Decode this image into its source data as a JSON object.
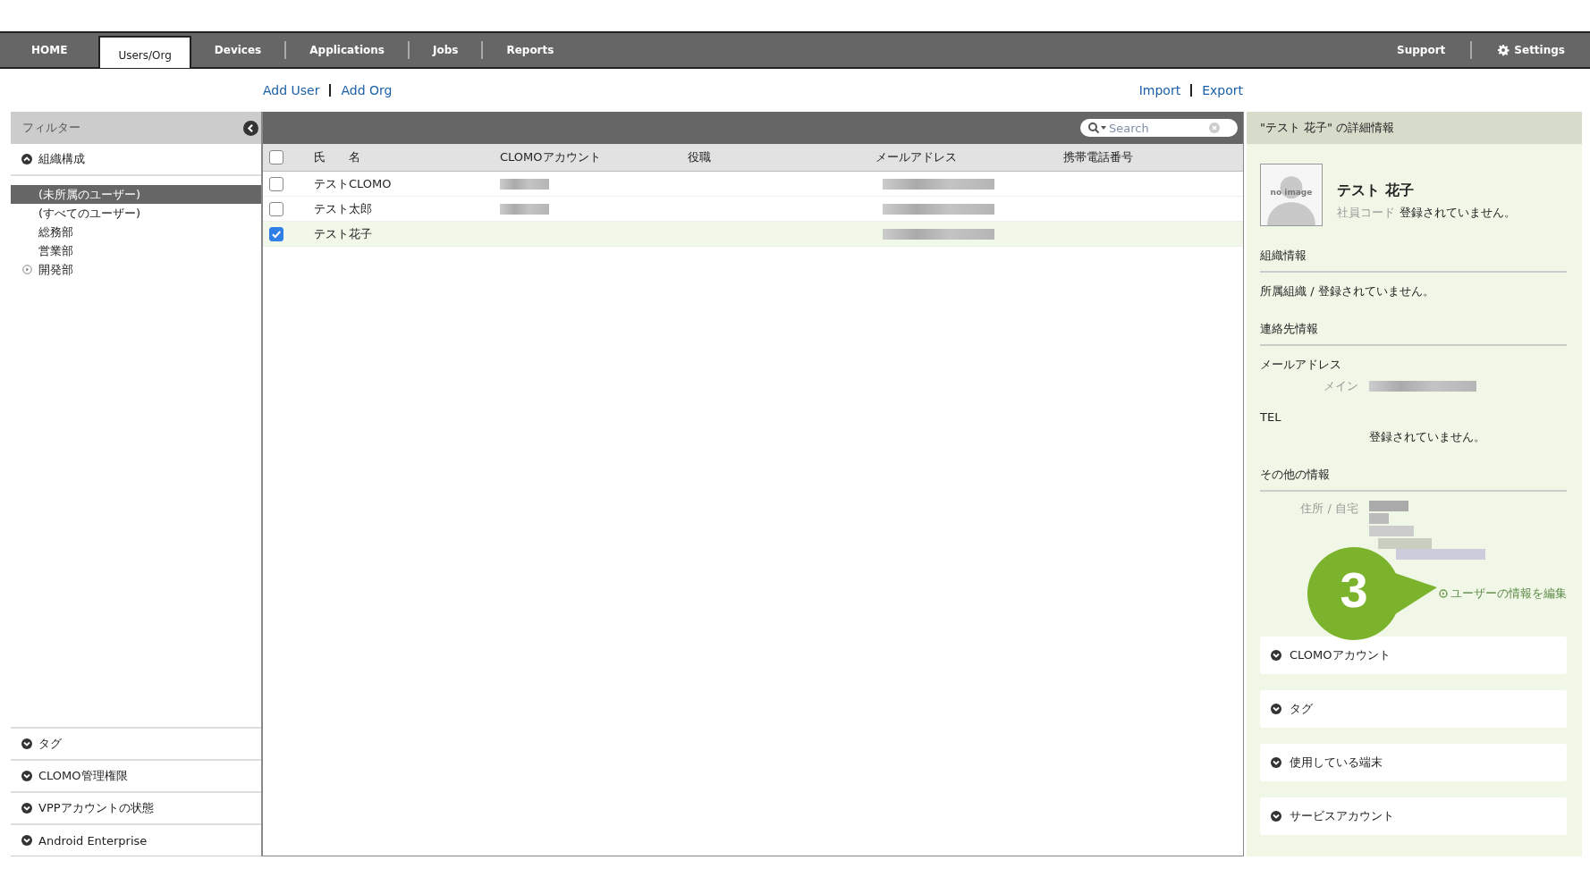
{
  "nav": {
    "tabs": [
      {
        "label": "HOME",
        "selected": false
      },
      {
        "label": "Users/Org",
        "selected": true
      },
      {
        "label": "Devices",
        "selected": false
      },
      {
        "label": "Applications",
        "selected": false
      },
      {
        "label": "Jobs",
        "selected": false
      },
      {
        "label": "Reports",
        "selected": false
      }
    ],
    "right": [
      {
        "label": "Support",
        "kind": "plain"
      },
      {
        "label": "Settings",
        "kind": "gear"
      }
    ]
  },
  "actions_left": [
    "Add User",
    "Add Org"
  ],
  "actions_right": [
    "Import",
    "Export"
  ],
  "filter": {
    "title": "フィルター",
    "section": {
      "label": "組織構成",
      "expanded": true
    },
    "items": [
      {
        "label": "(未所属のユーザー)",
        "selected": true,
        "kind": "leaf"
      },
      {
        "label": "(すべてのユーザー)",
        "selected": false,
        "kind": "leaf"
      },
      {
        "label": "総務部",
        "selected": false,
        "kind": "leaf"
      },
      {
        "label": "営業部",
        "selected": false,
        "kind": "leaf"
      },
      {
        "label": "開発部",
        "selected": false,
        "kind": "branch"
      }
    ],
    "groups": [
      "タグ",
      "CLOMO管理権限",
      "VPPアカウントの状態",
      "Android Enterprise"
    ]
  },
  "table": {
    "search": {
      "placeholder": "Search"
    },
    "header_checked": false,
    "columns": [
      "氏　　名",
      "CLOMOアカウント",
      "役職",
      "メールアドレス",
      "携帯電話番号"
    ],
    "rows": [
      {
        "name": "テストCLOMO",
        "checked": false,
        "selected": false,
        "account_redacted": true,
        "email_redacted": true
      },
      {
        "name": "テスト太郎",
        "checked": false,
        "selected": false,
        "account_redacted": true,
        "email_redacted": true
      },
      {
        "name": "テスト花子",
        "checked": true,
        "selected": true,
        "account_redacted": false,
        "email_redacted": true
      }
    ]
  },
  "detail": {
    "title": "\"テスト 花子\" の詳細情報",
    "avatar_label": "no image",
    "name": "テスト 花子",
    "code_label": "社員コード",
    "code_value": "登録されていません。",
    "org_heading": "組織情報",
    "org_line": "所属組織 / 登録されていません。",
    "contact_heading": "連絡先情報",
    "email_label": "メールアドレス",
    "email_sub": "メイン",
    "tel_label": "TEL",
    "tel_value": "登録されていません。",
    "other_heading": "その他の情報",
    "address_label": "住所 / 自宅",
    "edit_link": "ユーザーの情報を編集",
    "sections": [
      "CLOMOアカウント",
      "タグ",
      "使用している端末",
      "サービスアカウント"
    ]
  },
  "callout": {
    "number": "3"
  }
}
